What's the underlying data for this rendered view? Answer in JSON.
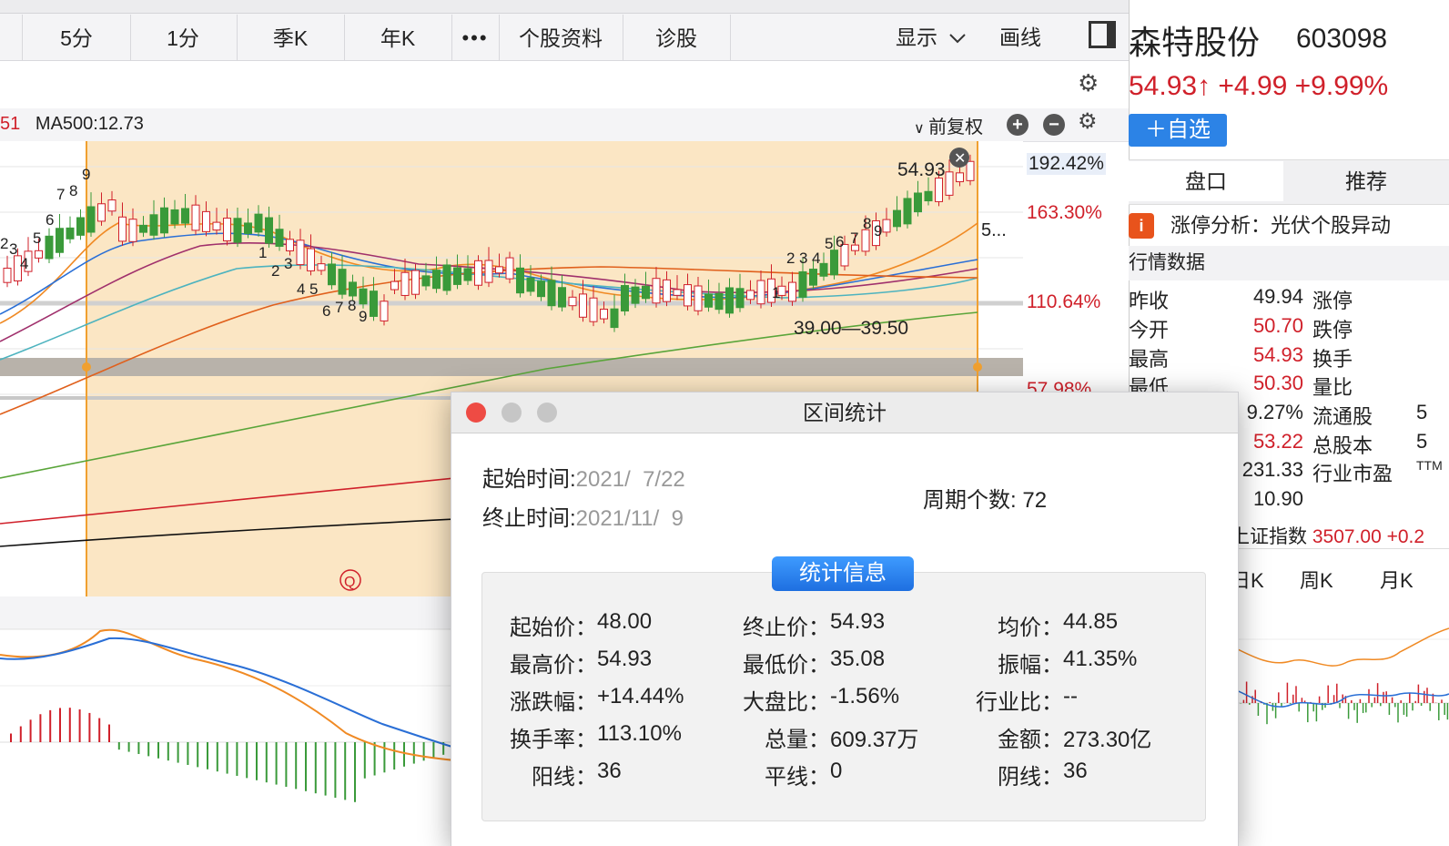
{
  "toolbar": {
    "tabs": [
      "5分",
      "1分",
      "季K",
      "年K",
      "•••",
      "个股资料",
      "诊股"
    ],
    "display_label": "显示",
    "draw_label": "画线"
  },
  "chart": {
    "ma_prefix": "51",
    "ma_label": "MA500:12.73",
    "fuquan_label": "前复权",
    "pct_labels": [
      "192.42%",
      "163.30%",
      "110.64%",
      "57.98%"
    ],
    "last_price_label": "54.93",
    "right_label": "5...",
    "range_label": "39.00—39.50",
    "seq_labels": [
      "2",
      "3",
      "4",
      "5",
      "6",
      "7",
      "8",
      "9",
      "1",
      "2",
      "3",
      "4",
      "5",
      "6",
      "7",
      "8",
      "9",
      "1",
      "2",
      "3",
      "4",
      "5",
      "6",
      "7",
      "8",
      "9"
    ],
    "q_marker": "Q"
  },
  "stock": {
    "name": "森特股份",
    "code": "603098",
    "price_line": "54.93↑ +4.99 +9.99%",
    "add_btn": "＋自选",
    "tabs": [
      "盘口",
      "推荐"
    ],
    "zt_icon": "i",
    "zt_label": "涨停分析：光伏个股异动",
    "hq_title": "行情数据",
    "quotes": [
      {
        "k": "昨收",
        "v": "49.94",
        "k2": "涨停",
        "v2": ""
      },
      {
        "k": "今开",
        "v": "50.70",
        "k2": "跌停",
        "v2": ""
      },
      {
        "k": "最高",
        "v": "54.93",
        "k2": "换手",
        "v2": ""
      },
      {
        "k": "最低",
        "v": "50.30",
        "k2": "量比",
        "v2": ""
      }
    ],
    "extra_rows": [
      {
        "v": "9.27%",
        "k2": "流通股",
        "v2": "5"
      },
      {
        "v": "53.22",
        "k2": "总股本",
        "v2": "5"
      },
      {
        "v": "231.33",
        "k2": "行业市盈",
        "v2": "TTM"
      },
      {
        "v": "10.90",
        "k2": "",
        "v2": ""
      }
    ],
    "index_label": "上证指数",
    "index_value": "3507.00 +0.2",
    "period_tabs": [
      "日K",
      "周K",
      "月K"
    ]
  },
  "dialog": {
    "title": "区间统计",
    "start_label": "起始时间:",
    "start_value": "2021/  7/22",
    "end_label": "终止时间:",
    "end_value": "2021/11/  9",
    "count_label": "周期个数:",
    "count_value": "72",
    "stat_btn": "统计信息",
    "stats": [
      {
        "k": "起始价：",
        "v": "48.00",
        "c": "normal"
      },
      {
        "k": "终止价：",
        "v": "54.93",
        "c": "normal"
      },
      {
        "k": "均价：",
        "v": "44.85",
        "c": "green"
      },
      {
        "k": "最高价：",
        "v": "54.93",
        "c": "red"
      },
      {
        "k": "最低价：",
        "v": "35.08",
        "c": "green"
      },
      {
        "k": "振幅：",
        "v": "41.35%",
        "c": "normal"
      },
      {
        "k": "涨跌幅：",
        "v": "+14.44%",
        "c": "red"
      },
      {
        "k": "大盘比：",
        "v": "-1.56%",
        "c": "green"
      },
      {
        "k": "行业比：",
        "v": "--",
        "c": "normal"
      },
      {
        "k": "换手率：",
        "v": "113.10%",
        "c": "normal"
      },
      {
        "k": "总量：",
        "v": "609.37万",
        "c": "normal"
      },
      {
        "k": "金额：",
        "v": "273.30亿",
        "c": "normal"
      },
      {
        "k": "阳线：",
        "v": "36",
        "c": "red"
      },
      {
        "k": "平线：",
        "v": "0",
        "c": "normal"
      },
      {
        "k": "阴线：",
        "v": "36",
        "c": "green"
      }
    ]
  },
  "colors": {
    "up": "#d0202a",
    "down": "#3a9a3a",
    "accent": "#2c83e6",
    "highlight": "#fbe6c4"
  }
}
